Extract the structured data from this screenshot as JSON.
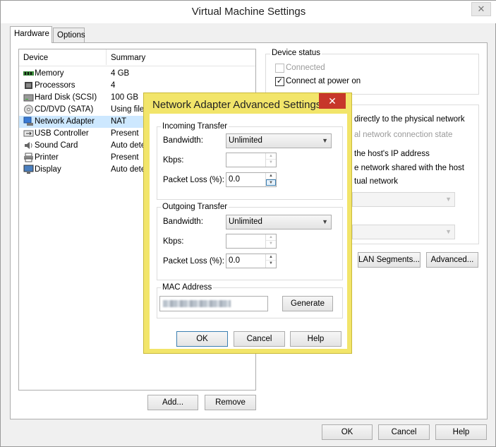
{
  "window": {
    "title": "Virtual Machine Settings",
    "close": "✕"
  },
  "tabs": [
    {
      "label": "Hardware"
    },
    {
      "label": "Options"
    }
  ],
  "device_list": {
    "headers": {
      "device": "Device",
      "summary": "Summary"
    },
    "items": [
      {
        "name": "Memory",
        "summary": "4 GB",
        "icon": "memory-icon"
      },
      {
        "name": "Processors",
        "summary": "4",
        "icon": "processor-icon"
      },
      {
        "name": "Hard Disk (SCSI)",
        "summary": "100 GB",
        "icon": "hard-disk-icon"
      },
      {
        "name": "CD/DVD (SATA)",
        "summary": "Using file",
        "icon": "cd-dvd-icon"
      },
      {
        "name": "Network Adapter",
        "summary": "NAT",
        "icon": "network-adapter-icon"
      },
      {
        "name": "USB Controller",
        "summary": "Present",
        "icon": "usb-icon"
      },
      {
        "name": "Sound Card",
        "summary": "Auto dete",
        "icon": "sound-card-icon"
      },
      {
        "name": "Printer",
        "summary": "Present",
        "icon": "printer-icon"
      },
      {
        "name": "Display",
        "summary": "Auto dete",
        "icon": "display-icon"
      }
    ],
    "selected_index": 4
  },
  "list_buttons": {
    "add": "Add...",
    "remove": "Remove"
  },
  "device_status": {
    "label": "Device status",
    "connected": "Connected",
    "connect_at_power_on": "Connect at power on"
  },
  "network_connection": {
    "bridged_fragment": "directly to the physical network",
    "replicate_fragment": "al network connection state",
    "nat_fragment": "the host's IP address",
    "hostonly_fragment": "e network shared with the host",
    "custom_fragment": "tual network",
    "lan_segments": "LAN Segments...",
    "advanced": "Advanced..."
  },
  "footer": {
    "ok": "OK",
    "cancel": "Cancel",
    "help": "Help"
  },
  "dialog": {
    "title": "Network Adapter Advanced Settings",
    "close": "✕",
    "incoming": {
      "label": "Incoming Transfer",
      "bandwidth_label": "Bandwidth:",
      "bandwidth_value": "Unlimited",
      "kbps_label": "Kbps:",
      "kbps_value": "",
      "packet_loss_label": "Packet Loss (%):",
      "packet_loss_value": "0.0"
    },
    "outgoing": {
      "label": "Outgoing Transfer",
      "bandwidth_label": "Bandwidth:",
      "bandwidth_value": "Unlimited",
      "kbps_label": "Kbps:",
      "kbps_value": "",
      "packet_loss_label": "Packet Loss (%):",
      "packet_loss_value": "0.0"
    },
    "mac": {
      "label": "MAC Address",
      "generate": "Generate"
    },
    "buttons": {
      "ok": "OK",
      "cancel": "Cancel",
      "help": "Help"
    }
  }
}
